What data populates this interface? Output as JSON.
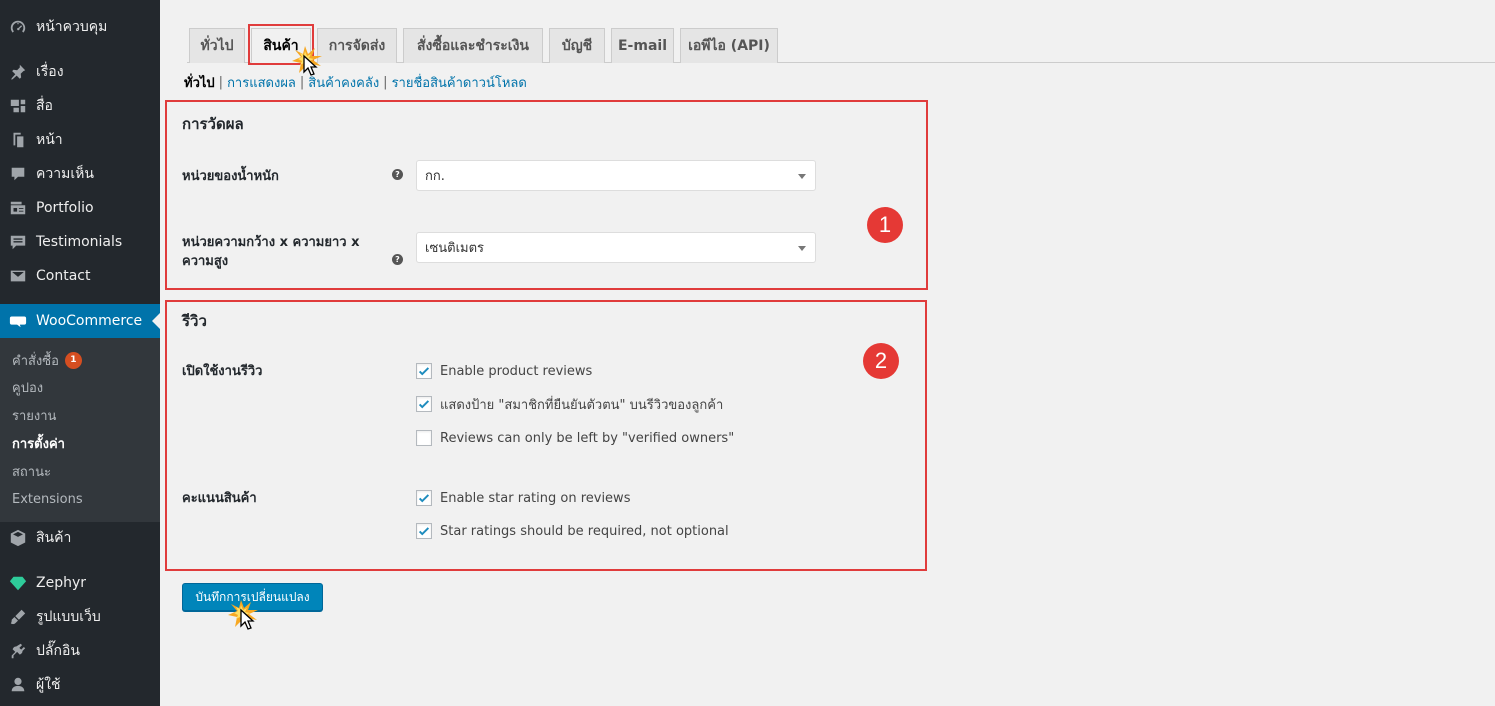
{
  "sidebar": {
    "items": [
      {
        "label": "หน้าควบคุม",
        "icon": "dashboard-icon"
      },
      {
        "label": "เรื่อง",
        "icon": "pin-icon"
      },
      {
        "label": "สื่อ",
        "icon": "media-icon"
      },
      {
        "label": "หน้า",
        "icon": "page-icon"
      },
      {
        "label": "ความเห็น",
        "icon": "comment-icon"
      },
      {
        "label": "Portfolio",
        "icon": "portfolio-icon"
      },
      {
        "label": "Testimonials",
        "icon": "testimonials-icon"
      },
      {
        "label": "Contact",
        "icon": "mail-icon"
      },
      {
        "label": "WooCommerce",
        "icon": "woocommerce-icon"
      },
      {
        "label": "สินค้า",
        "icon": "box-icon"
      },
      {
        "label": "Zephyr",
        "icon": "diamond-icon"
      },
      {
        "label": "รูปแบบเว็บ",
        "icon": "brush-icon"
      },
      {
        "label": "ปลั๊กอิน",
        "icon": "plugin-icon"
      },
      {
        "label": "ผู้ใช้",
        "icon": "user-icon"
      }
    ],
    "submenu": [
      {
        "label": "คำสั่งซื้อ",
        "badge": "1"
      },
      {
        "label": "คูปอง"
      },
      {
        "label": "รายงาน"
      },
      {
        "label": "การตั้งค่า"
      },
      {
        "label": "สถานะ"
      },
      {
        "label": "Extensions"
      }
    ]
  },
  "tabs": [
    "ทั่วไป",
    "สินค้า",
    "การจัดส่ง",
    "สั่งซื้อและชำระเงิน",
    "บัญชี",
    "E-mail",
    "เอพีไอ (API)"
  ],
  "subnav": {
    "current": "ทั่วไป",
    "links": [
      "การแสดงผล",
      "สินค้าคงคลัง",
      "รายชื่อสินค้าดาวน์โหลด"
    ]
  },
  "measurements": {
    "title": "การวัดผล",
    "weight_label": "หน่วยของน้ำหนัก",
    "weight_value": "กก.",
    "dimension_label": "หน่วยความกว้าง x ความยาว x ความสูง",
    "dimension_value": "เซนติเมตร",
    "marker": "1"
  },
  "reviews": {
    "title": "รีวิว",
    "enable_label": "เปิดใช้งานรีวิว",
    "options": [
      {
        "label": "Enable product reviews",
        "checked": true
      },
      {
        "label": "แสดงป้าย \"สมาชิกที่ยืนยันตัวตน\" บนรีวิวของลูกค้า",
        "checked": true
      },
      {
        "label": "Reviews can only be left by \"verified owners\"",
        "checked": false
      }
    ],
    "rating_label": "คะแนนสินค้า",
    "rating_options": [
      {
        "label": "Enable star rating on reviews",
        "checked": true
      },
      {
        "label": "Star ratings should be required, not optional",
        "checked": true
      }
    ],
    "marker": "2"
  },
  "save_label": "บันทึกการเปลี่ยนแปลง",
  "colors": {
    "accent": "#0073aa",
    "highlight": "#e03c3c",
    "sidebar": "#23282d"
  }
}
